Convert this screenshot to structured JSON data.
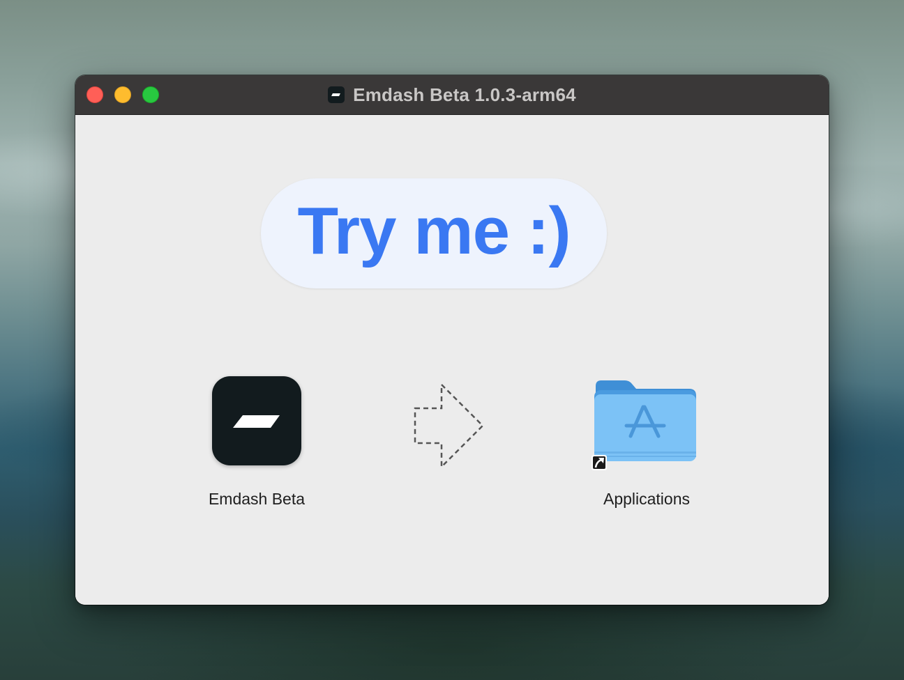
{
  "window": {
    "title": "Emdash Beta 1.0.3-arm64"
  },
  "banner": {
    "text": "Try me :)",
    "color": "#3a78f2"
  },
  "items": {
    "app": {
      "label": "Emdash Beta",
      "icon": "emdash-app-icon"
    },
    "arrow": {
      "icon": "dashed-arrow-right-icon"
    },
    "folder": {
      "label": "Applications",
      "icon": "applications-folder-icon",
      "badge": "alias-arrow-icon"
    }
  },
  "colors": {
    "traffic_close": "#ff5f57",
    "traffic_minimize": "#febc2e",
    "traffic_zoom": "#28c840",
    "titlebar": "#3a3838",
    "content_bg": "#ececec"
  }
}
